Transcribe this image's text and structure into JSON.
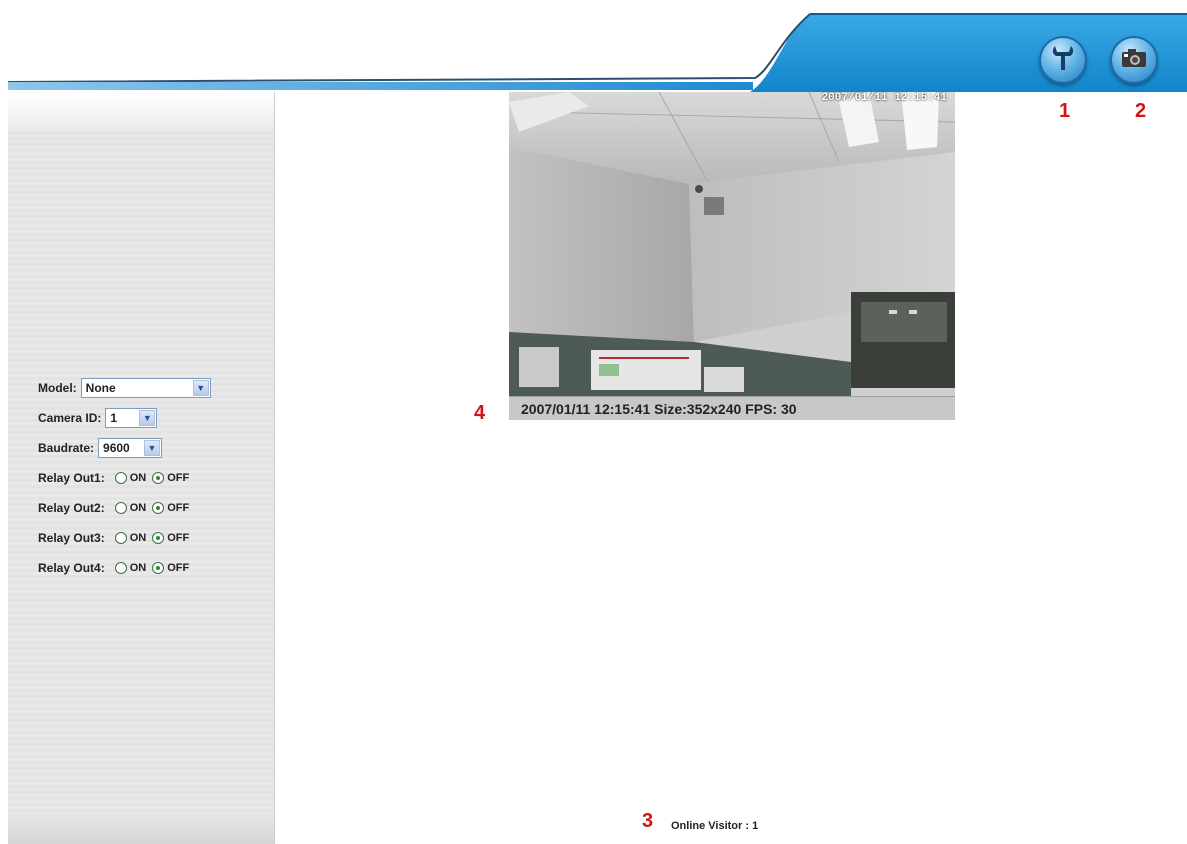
{
  "header": {
    "settings_icon": "wrench-icon",
    "snapshot_icon": "camera-icon",
    "accent_color": "#1e96d6"
  },
  "callouts": [
    "1",
    "2",
    "3",
    "4"
  ],
  "controls": {
    "model_label": "Model:",
    "model_value": "None",
    "camera_id_label": "Camera ID:",
    "camera_id_value": "1",
    "baudrate_label": "Baudrate:",
    "baudrate_value": "9600",
    "relays": [
      {
        "label": "Relay Out1:",
        "on": "ON",
        "off": "OFF",
        "selected": "OFF"
      },
      {
        "label": "Relay Out2:",
        "on": "ON",
        "off": "OFF",
        "selected": "OFF"
      },
      {
        "label": "Relay Out3:",
        "on": "ON",
        "off": "OFF",
        "selected": "OFF"
      },
      {
        "label": "Relay Out4:",
        "on": "ON",
        "off": "OFF",
        "selected": "OFF"
      }
    ]
  },
  "video": {
    "overlay_timestamp": "2007/01/11 12:15:41",
    "status": "2007/01/11 12:15:41 Size:352x240 FPS: 30"
  },
  "footer": {
    "online_visitor": "Online Visitor : 1"
  }
}
